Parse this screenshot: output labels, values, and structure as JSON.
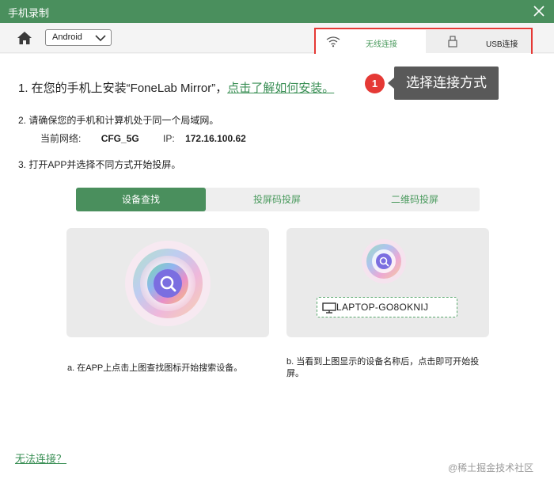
{
  "window": {
    "title": "手机录制"
  },
  "toolbar": {
    "platform_select": "Android"
  },
  "connection": {
    "wifi_label": "无线连接",
    "usb_label": "USB连接"
  },
  "step1": {
    "text": "1. 在您的手机上安装“FoneLab Mirror”，",
    "link": "点击了解如何安装。"
  },
  "annotation": {
    "number": "1",
    "label": "选择连接方式"
  },
  "step2": {
    "text": "2. 请确保您的手机和计算机处于同一个局域网。",
    "network_label": "当前网络:",
    "network_value": "CFG_5G",
    "ip_label": "IP:",
    "ip_value": "172.16.100.62"
  },
  "step3": {
    "text": "3. 打开APP并选择不同方式开始投屏。"
  },
  "method_tabs": [
    "设备查找",
    "投屏码投屏",
    "二维码投屏"
  ],
  "cards": {
    "device_name": "LAPTOP-GO8OKNIJ",
    "desc_a": "a. 在APP上点击上图查找图标开始搜索设备。",
    "desc_b": "b. 当看到上图显示的设备名称后，点击即可开始投屏。"
  },
  "footer": {
    "cant_connect": "无法连接？",
    "watermark": "@稀土掘金技术社区"
  },
  "colors": {
    "brand_green": "#4a8f5d",
    "annotation_red": "#e53935",
    "callout_gray": "#595959"
  }
}
